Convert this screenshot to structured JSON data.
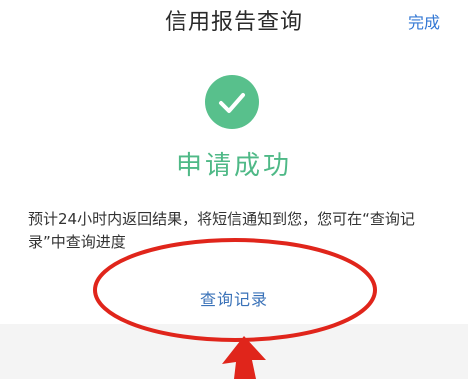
{
  "header": {
    "title": "信用报告查询",
    "done_label": "完成"
  },
  "result": {
    "icon": "checkmark-icon",
    "title": "申请成功",
    "notice": "预计24小时内返回结果，将短信通知到您，您可在“查询记录”中查询进度"
  },
  "actions": {
    "records_link": "查询记录"
  },
  "colors": {
    "success_green": "#58c08c",
    "link_blue": "#3a72b8",
    "annotation_red": "#e0251b"
  }
}
